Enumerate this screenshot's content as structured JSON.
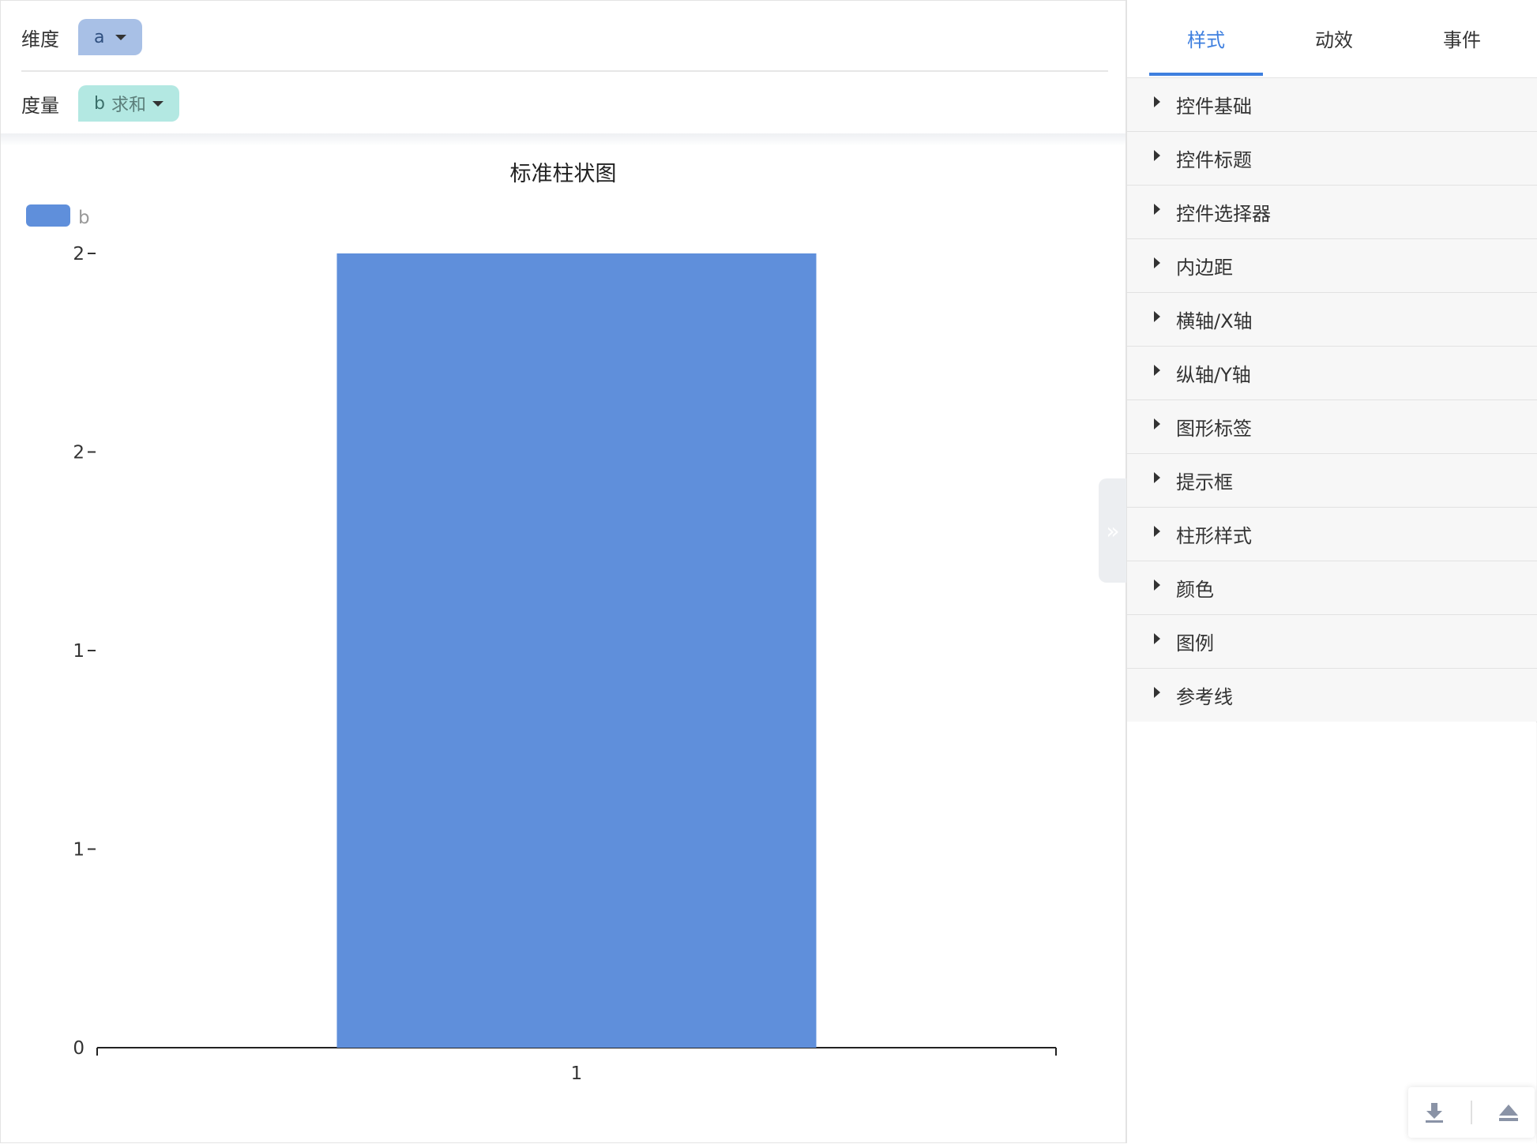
{
  "fields": {
    "dimension_label": "维度",
    "dimension_value": "a",
    "measure_label": "度量",
    "measure_value": "b",
    "measure_agg": "求和"
  },
  "panel": {
    "tabs": [
      {
        "label": "样式",
        "active": true
      },
      {
        "label": "动效",
        "active": false
      },
      {
        "label": "事件",
        "active": false
      }
    ],
    "sections": [
      "控件基础",
      "控件标题",
      "控件选择器",
      "内边距",
      "横轴/X轴",
      "纵轴/Y轴",
      "图形标签",
      "提示框",
      "柱形样式",
      "颜色",
      "图例",
      "参考线"
    ]
  },
  "colors": {
    "bar": "#5f8fdb",
    "accent": "#3e7fdf",
    "dimension_pill": "#a8c0e6",
    "measure_pill": "#b3e8e2"
  },
  "icons": {
    "collapse": "double-chevron-right-icon",
    "download": "download-icon",
    "eject": "eject-icon"
  },
  "chart_data": {
    "type": "bar",
    "title": "标准柱状图",
    "categories": [
      "1"
    ],
    "series": [
      {
        "name": "b",
        "values": [
          2
        ]
      }
    ],
    "yticks": [
      "0",
      "1",
      "1",
      "2",
      "2"
    ],
    "ylim": [
      0,
      2
    ],
    "legend": "top-left",
    "grid": false,
    "xlabel": "",
    "ylabel": ""
  }
}
